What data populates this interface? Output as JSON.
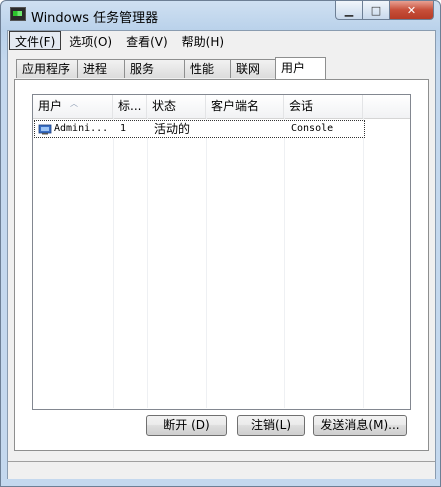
{
  "window": {
    "title": "Windows 任务管理器"
  },
  "caption": {
    "minimize": "▁",
    "maximize": "□",
    "close": "✕"
  },
  "menu": [
    "文件(F)",
    "选项(O)",
    "查看(V)",
    "帮助(H)"
  ],
  "tabs": [
    "应用程序",
    "进程",
    "服务",
    "性能",
    "联网",
    "用户"
  ],
  "selected_tab": "用户",
  "columns": [
    "用户",
    "标...",
    "状态",
    "客户端名",
    "会话"
  ],
  "rows": [
    {
      "user": "Admini...",
      "id": "1",
      "status": "活动的",
      "client": "",
      "session": "Console"
    }
  ],
  "buttons": {
    "disconnect": "断开 (D)",
    "logoff": "注销(L)",
    "send_message": "发送消息(M)..."
  },
  "icons": {
    "app": "task-manager-icon",
    "user": "users-icon",
    "sort": "sort-ascending-icon"
  }
}
